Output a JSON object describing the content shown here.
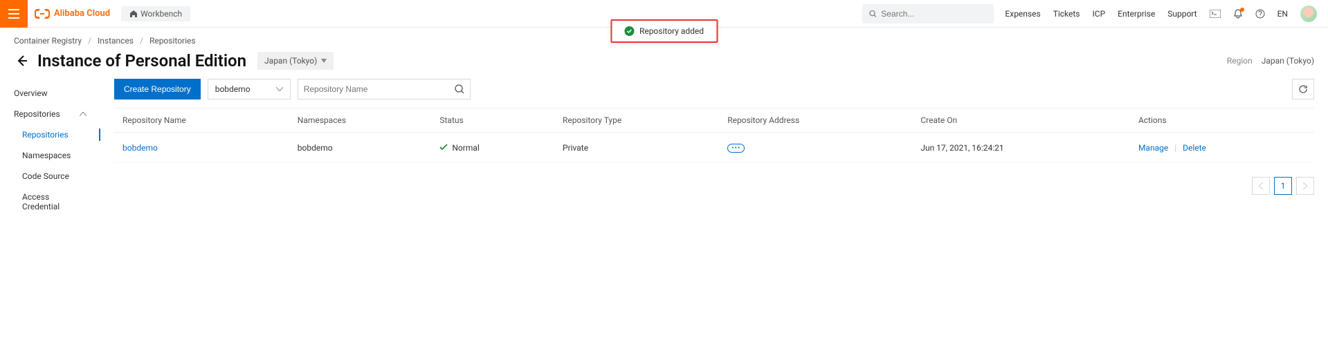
{
  "toast": {
    "message": "Repository added"
  },
  "brand": "Alibaba Cloud",
  "workbench": "Workbench",
  "search_placeholder": "Search...",
  "top_links": [
    "Expenses",
    "Tickets",
    "ICP",
    "Enterprise",
    "Support"
  ],
  "lang": "EN",
  "breadcrumb": {
    "a": "Container Registry",
    "b": "Instances",
    "c": "Repositories"
  },
  "title": "Instance of Personal Edition",
  "region_selected": "Japan (Tokyo)",
  "region_label": "Region",
  "region_value": "Japan (Tokyo)",
  "sidebar": {
    "overview": "Overview",
    "repositories_group": "Repositories",
    "repositories": "Repositories",
    "namespaces": "Namespaces",
    "code_source": "Code Source",
    "access_credential": "Access Credential"
  },
  "toolbar": {
    "create": "Create Repository",
    "namespace_selected": "bobdemo",
    "search_placeholder": "Repository Name"
  },
  "columns": {
    "name": "Repository Name",
    "ns": "Namespaces",
    "status": "Status",
    "type": "Repository Type",
    "addr": "Repository Address",
    "created": "Create On",
    "actions": "Actions"
  },
  "rows": [
    {
      "name": "bobdemo",
      "ns": "bobdemo",
      "status": "Normal",
      "type": "Private",
      "created": "Jun 17, 2021, 16:24:21",
      "manage": "Manage",
      "delete": "Delete"
    }
  ],
  "pagination": {
    "current": "1"
  }
}
